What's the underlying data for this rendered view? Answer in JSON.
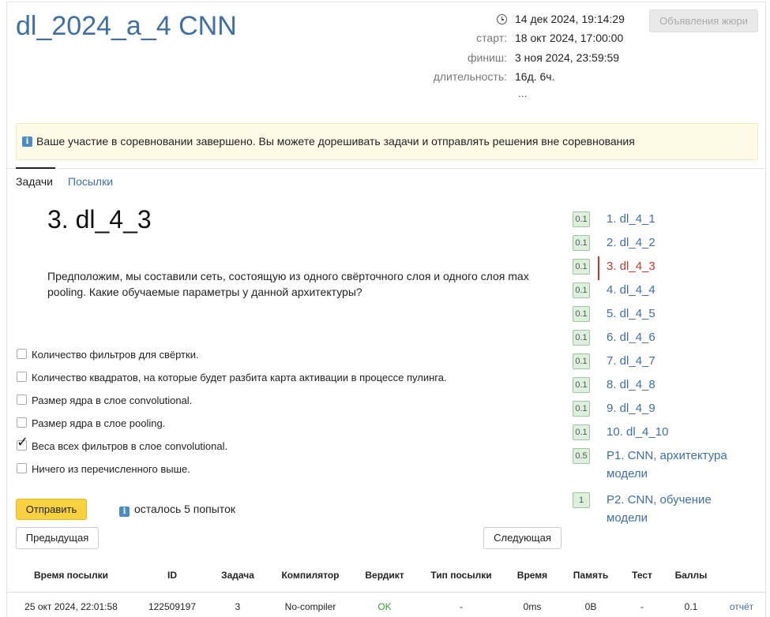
{
  "header": {
    "title": "dl_2024_a_4 CNN",
    "now": "14 дек 2024, 19:14:29",
    "start_label": "старт:",
    "start": "18 окт 2024, 17:00:00",
    "finish_label": "финиш:",
    "finish": "3 ноя 2024, 23:59:59",
    "duration_label": "длительность:",
    "duration": "16д. 6ч.",
    "ellipsis": "...",
    "jury_button": "Объявления жюри"
  },
  "notice": {
    "icon": "i",
    "text": "Ваше участие в соревновании завершено. Вы можете дорешивать задачи и отправлять решения вне соревнования"
  },
  "tabs": [
    {
      "label": "Задачи"
    },
    {
      "label": "Посылки"
    }
  ],
  "task": {
    "title": "3. dl_4_3",
    "text": "Предположим, мы составили сеть, состоящую из одного свёрточного слоя и одного слоя max pooling. Какие обучаемые параметры у данной архитектуры?",
    "options": [
      {
        "label": "Количество фильтров для свёртки.",
        "checked": false
      },
      {
        "label": "Количество квадратов, на которые будет разбита карта активации в процессе пулинга.",
        "checked": false
      },
      {
        "label": "Размер ядра в слое convolutional.",
        "checked": false
      },
      {
        "label": "Размер ядра в слое pooling.",
        "checked": false
      },
      {
        "label": "Веса всех фильтров в слое convolutional.",
        "checked": true
      },
      {
        "label": "Ничего из перечисленного выше.",
        "checked": false
      }
    ],
    "send_button": "Отправить",
    "attempts_icon": "i",
    "attempts_text": "осталось 5 попыток",
    "prev_button": "Предыдущая",
    "next_button": "Следующая"
  },
  "problems": [
    {
      "score": "0.1",
      "label": "1. dl_4_1"
    },
    {
      "score": "0.1",
      "label": "2. dl_4_2"
    },
    {
      "score": "0.1",
      "label": "3. dl_4_3"
    },
    {
      "score": "0.1",
      "label": "4. dl_4_4"
    },
    {
      "score": "0.1",
      "label": "5. dl_4_5"
    },
    {
      "score": "0.1",
      "label": "6. dl_4_6"
    },
    {
      "score": "0.1",
      "label": "7. dl_4_7"
    },
    {
      "score": "0.1",
      "label": "8. dl_4_8"
    },
    {
      "score": "0.1",
      "label": "9. dl_4_9"
    },
    {
      "score": "0.1",
      "label": "10. dl_4_10"
    },
    {
      "score": "0.5",
      "label": "P1. CNN, архитектура модели"
    },
    {
      "score": "1",
      "label": "P2. CNN, обучение модели"
    }
  ],
  "submissions": {
    "headers": [
      "Время посылки",
      "ID",
      "Задача",
      "Компилятор",
      "Вердикт",
      "Тип посылки",
      "Время",
      "Память",
      "Тест",
      "Баллы"
    ],
    "rows": [
      {
        "time": "25 окт 2024, 22:01:58",
        "id": "122509197",
        "task": "3",
        "compiler": "No-compiler",
        "verdict": "OK",
        "type": "-",
        "runtime": "0ms",
        "memory": "0B",
        "test": "-",
        "score": "0.1",
        "report": "отчёт"
      }
    ]
  },
  "colors": {
    "link": "#3d6fa6",
    "active": "#c0392b",
    "send_button": "#f7d23e",
    "notice_bg": "#fdfbe5",
    "score_badge": "#ddf0dd",
    "ok": "#3a9a3a"
  }
}
